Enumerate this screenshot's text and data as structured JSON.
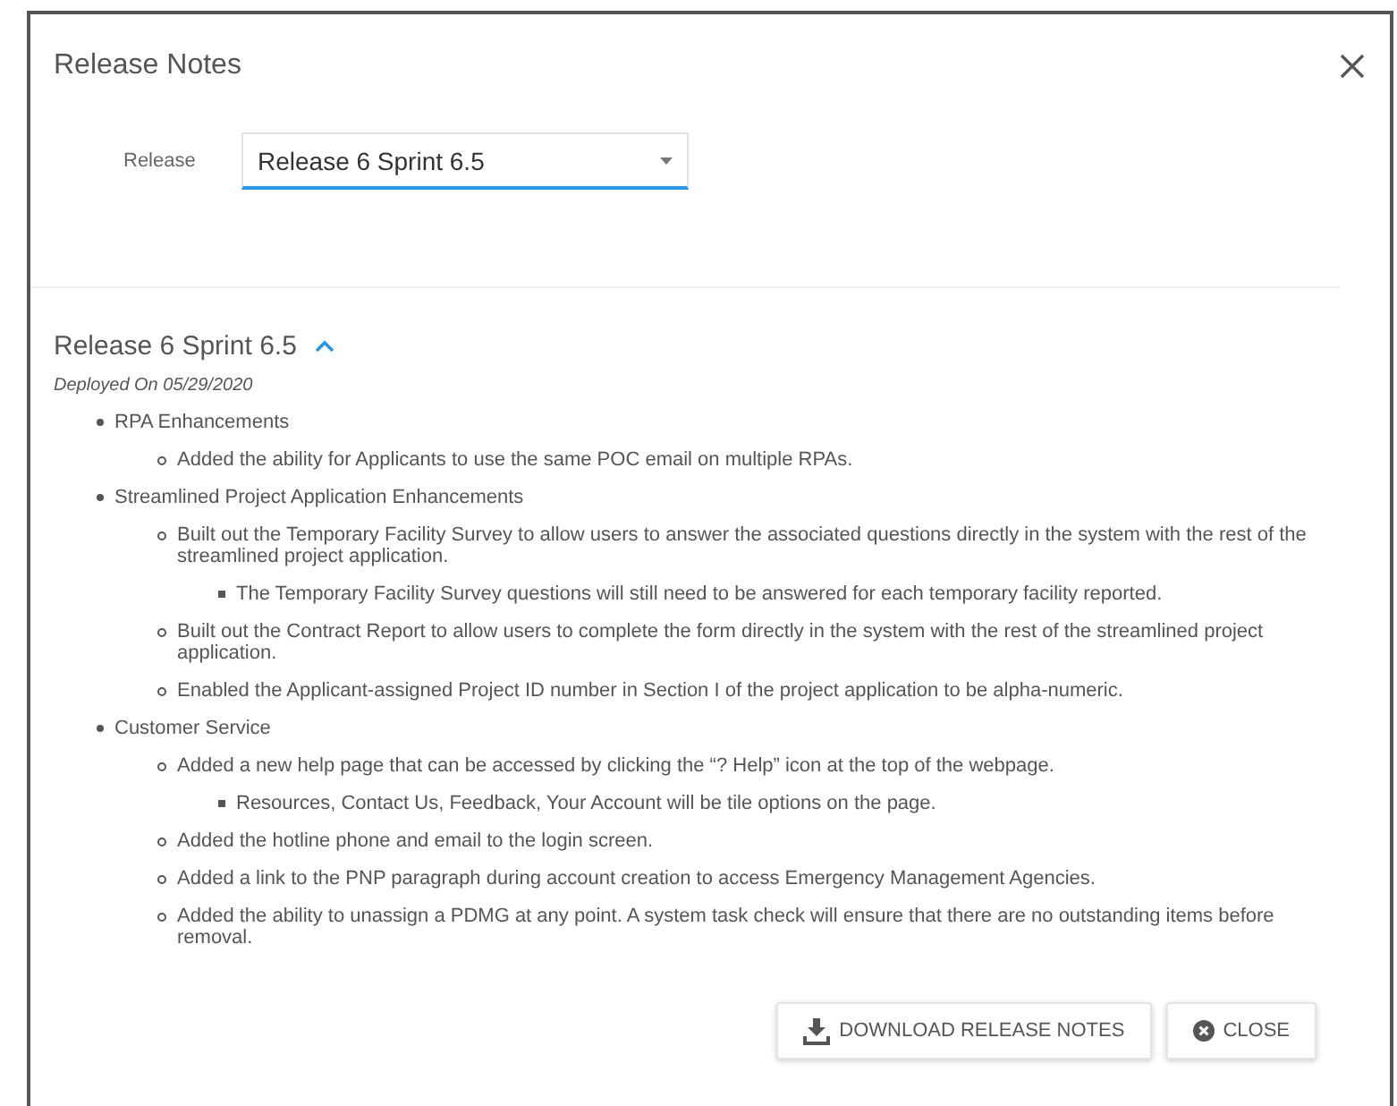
{
  "dialog": {
    "title": "Release Notes"
  },
  "release_field": {
    "label": "Release",
    "value": "Release 6 Sprint 6.5"
  },
  "section": {
    "title": "Release 6 Sprint 6.5",
    "expanded": true,
    "deployed": "Deployed On 05/29/2020",
    "items": [
      {
        "text": "RPA Enhancements",
        "children": [
          {
            "text": "Added the ability for Applicants to use the same POC email on multiple RPAs."
          }
        ]
      },
      {
        "text": "Streamlined Project Application Enhancements",
        "children": [
          {
            "text": "Built out the Temporary Facility Survey to allow users to answer the associated questions directly in the system with the rest of the streamlined project application.",
            "children": [
              {
                "text": "The Temporary Facility Survey questions will still need to be answered for each temporary facility reported."
              }
            ]
          },
          {
            "text": "Built out the Contract Report to allow users to complete the form directly in the system with the rest of the streamlined project application."
          },
          {
            "text": "Enabled the Applicant-assigned Project ID number in Section I of the project application to be alpha-numeric."
          }
        ]
      },
      {
        "text": "Customer Service",
        "children": [
          {
            "text": "Added a new help page that can be accessed by clicking the “? Help” icon at the top of the webpage.",
            "children": [
              {
                "text": "Resources, Contact Us, Feedback, Your Account will be tile options on the page."
              }
            ]
          },
          {
            "text": "Added the hotline phone and email to the login screen."
          },
          {
            "text": "Added a link to the PNP paragraph during account creation to access Emergency Management Agencies."
          },
          {
            "text": "Added the ability to unassign a PDMG at any point. A system task check will ensure that there are no outstanding items before removal."
          }
        ]
      }
    ]
  },
  "buttons": [
    {
      "kind": "download",
      "label": "DOWNLOAD RELEASE NOTES"
    },
    {
      "kind": "close",
      "label": "CLOSE"
    }
  ]
}
